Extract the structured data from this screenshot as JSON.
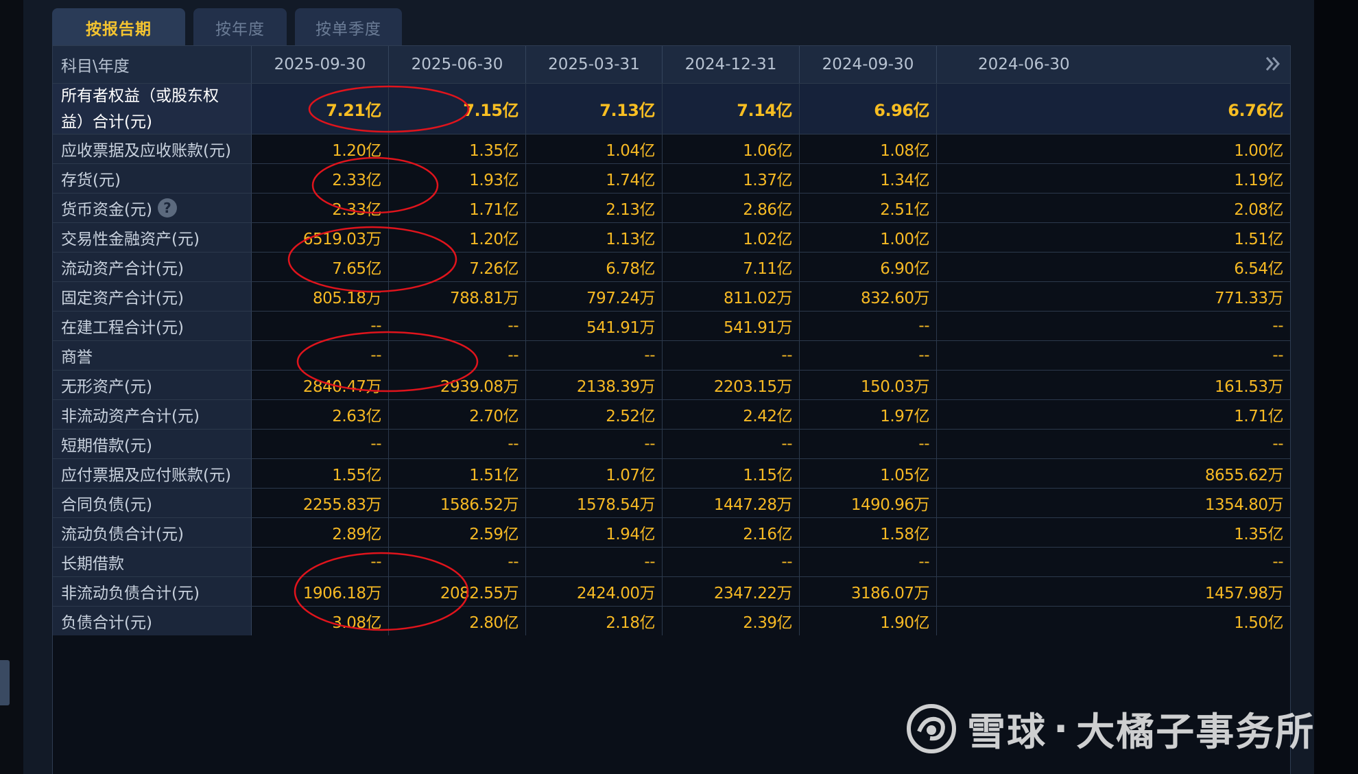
{
  "tabs": [
    {
      "label": "按报告期",
      "active": true
    },
    {
      "label": "按年度",
      "active": false
    },
    {
      "label": "按单季度",
      "active": false
    }
  ],
  "table": {
    "corner_label": "科目\\年度",
    "dates": [
      "2025-09-30",
      "2025-06-30",
      "2025-03-31",
      "2024-12-31",
      "2024-09-30",
      "2024-06-30"
    ],
    "rows": [
      {
        "label": "所有者权益（或股东权益）合计(元)",
        "values": [
          "7.21亿",
          "7.15亿",
          "7.13亿",
          "7.14亿",
          "6.96亿",
          "6.76亿"
        ]
      },
      {
        "label": "应收票据及应收账款(元)",
        "values": [
          "1.20亿",
          "1.35亿",
          "1.04亿",
          "1.06亿",
          "1.08亿",
          "1.00亿"
        ]
      },
      {
        "label": "存货(元)",
        "values": [
          "2.33亿",
          "1.93亿",
          "1.74亿",
          "1.37亿",
          "1.34亿",
          "1.19亿"
        ]
      },
      {
        "label": "货币资金(元)",
        "values": [
          "2.33亿",
          "1.71亿",
          "2.13亿",
          "2.86亿",
          "2.51亿",
          "2.08亿"
        ]
      },
      {
        "label": "交易性金融资产(元)",
        "values": [
          "6519.03万",
          "1.20亿",
          "1.13亿",
          "1.02亿",
          "1.00亿",
          "1.51亿"
        ]
      },
      {
        "label": "流动资产合计(元)",
        "values": [
          "7.65亿",
          "7.26亿",
          "6.78亿",
          "7.11亿",
          "6.90亿",
          "6.54亿"
        ]
      },
      {
        "label": "固定资产合计(元)",
        "values": [
          "805.18万",
          "788.81万",
          "797.24万",
          "811.02万",
          "832.60万",
          "771.33万"
        ]
      },
      {
        "label": "在建工程合计(元)",
        "values": [
          "--",
          "--",
          "541.91万",
          "541.91万",
          "--",
          "--"
        ]
      },
      {
        "label": "商誉",
        "values": [
          "--",
          "--",
          "--",
          "--",
          "--",
          "--"
        ]
      },
      {
        "label": "无形资产(元)",
        "values": [
          "2840.47万",
          "2939.08万",
          "2138.39万",
          "2203.15万",
          "150.03万",
          "161.53万"
        ]
      },
      {
        "label": "非流动资产合计(元)",
        "values": [
          "2.63亿",
          "2.70亿",
          "2.52亿",
          "2.42亿",
          "1.97亿",
          "1.71亿"
        ]
      },
      {
        "label": "短期借款(元)",
        "values": [
          "--",
          "--",
          "--",
          "--",
          "--",
          "--"
        ]
      },
      {
        "label": "应付票据及应付账款(元)",
        "values": [
          "1.55亿",
          "1.51亿",
          "1.07亿",
          "1.15亿",
          "1.05亿",
          "8655.62万"
        ]
      },
      {
        "label": "合同负债(元)",
        "values": [
          "2255.83万",
          "1586.52万",
          "1578.54万",
          "1447.28万",
          "1490.96万",
          "1354.80万"
        ]
      },
      {
        "label": "流动负债合计(元)",
        "values": [
          "2.89亿",
          "2.59亿",
          "1.94亿",
          "2.16亿",
          "1.58亿",
          "1.35亿"
        ]
      },
      {
        "label": "长期借款",
        "values": [
          "--",
          "--",
          "--",
          "--",
          "--",
          "--"
        ]
      },
      {
        "label": "非流动负债合计(元)",
        "values": [
          "1906.18万",
          "2082.55万",
          "2424.00万",
          "2347.22万",
          "3186.07万",
          "1457.98万"
        ]
      },
      {
        "label": "负债合计(元)",
        "values": [
          "3.08亿",
          "2.80亿",
          "2.18亿",
          "2.39亿",
          "1.90亿",
          "1.50亿"
        ]
      }
    ]
  },
  "annotation_color": "#e0141c",
  "value_color": "#f6b924",
  "watermark": {
    "brand": "雪球",
    "separator": "·",
    "author": "大橘子事务所"
  },
  "icons": {
    "help": "question-circle-icon",
    "more": "double-chevron-right-icon",
    "logo": "snowball-logo-icon"
  }
}
